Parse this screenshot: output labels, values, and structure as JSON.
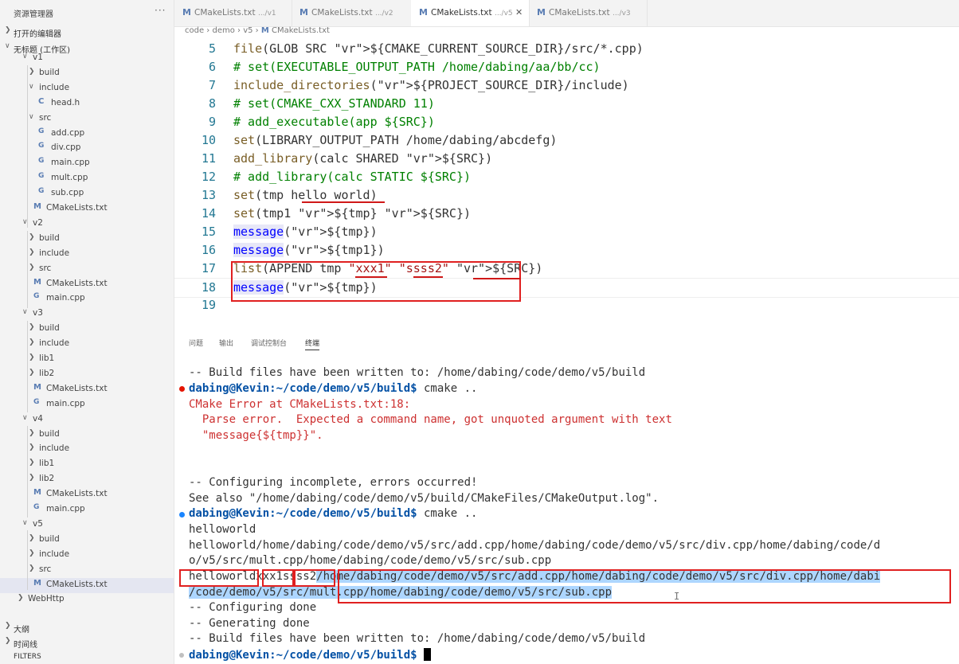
{
  "explorer": {
    "title": "资源管理器",
    "more": "···",
    "open_editors": "打开的编辑器",
    "workspace": "无标题 (工作区)",
    "tree": [
      {
        "label": "v1",
        "kind": "folder",
        "open": true
      },
      {
        "label": "build",
        "kind": "folder",
        "open": false
      },
      {
        "label": "include",
        "kind": "folder",
        "open": true
      },
      {
        "label": "head.h",
        "kind": "c"
      },
      {
        "label": "src",
        "kind": "folder",
        "open": true
      },
      {
        "label": "add.cpp",
        "kind": "cpp"
      },
      {
        "label": "div.cpp",
        "kind": "cpp"
      },
      {
        "label": "main.cpp",
        "kind": "cpp"
      },
      {
        "label": "mult.cpp",
        "kind": "cpp"
      },
      {
        "label": "sub.cpp",
        "kind": "cpp"
      },
      {
        "label": "CMakeLists.txt",
        "kind": "cmake"
      },
      {
        "label": "v2",
        "kind": "folder",
        "open": true
      },
      {
        "label": "build",
        "kind": "folder",
        "open": false
      },
      {
        "label": "include",
        "kind": "folder",
        "open": false
      },
      {
        "label": "src",
        "kind": "folder",
        "open": false
      },
      {
        "label": "CMakeLists.txt",
        "kind": "cmake"
      },
      {
        "label": "main.cpp",
        "kind": "cpp"
      },
      {
        "label": "v3",
        "kind": "folder",
        "open": true
      },
      {
        "label": "build",
        "kind": "folder",
        "open": false
      },
      {
        "label": "include",
        "kind": "folder",
        "open": false
      },
      {
        "label": "lib1",
        "kind": "folder",
        "open": false
      },
      {
        "label": "lib2",
        "kind": "folder",
        "open": false
      },
      {
        "label": "CMakeLists.txt",
        "kind": "cmake"
      },
      {
        "label": "main.cpp",
        "kind": "cpp"
      },
      {
        "label": "v4",
        "kind": "folder",
        "open": true
      },
      {
        "label": "build",
        "kind": "folder",
        "open": false
      },
      {
        "label": "include",
        "kind": "folder",
        "open": false
      },
      {
        "label": "lib1",
        "kind": "folder",
        "open": false
      },
      {
        "label": "lib2",
        "kind": "folder",
        "open": false
      },
      {
        "label": "CMakeLists.txt",
        "kind": "cmake"
      },
      {
        "label": "main.cpp",
        "kind": "cpp"
      },
      {
        "label": "v5",
        "kind": "folder",
        "open": true
      },
      {
        "label": "build",
        "kind": "folder",
        "open": false
      },
      {
        "label": "include",
        "kind": "folder",
        "open": false
      },
      {
        "label": "src",
        "kind": "folder",
        "open": false
      },
      {
        "label": "CMakeLists.txt",
        "kind": "cmake",
        "selected": true
      },
      {
        "label": "WebHttp",
        "kind": "folder",
        "open": false
      }
    ],
    "outline": "大纲",
    "timeline": "时间线",
    "filters": "FILTERS"
  },
  "tabs": [
    {
      "name": "CMakeLists.txt",
      "dir": ".../v1"
    },
    {
      "name": "CMakeLists.txt",
      "dir": ".../v2"
    },
    {
      "name": "CMakeLists.txt",
      "dir": ".../v5",
      "active": true
    },
    {
      "name": "CMakeLists.txt",
      "dir": ".../v3"
    }
  ],
  "breadcrumb": [
    "code",
    "demo",
    "v5",
    "CMakeLists.txt"
  ],
  "code_lines": [
    {
      "n": "5",
      "text": "file(GLOB SRC ${CMAKE_CURRENT_SOURCE_DIR}/src/*.cpp)"
    },
    {
      "n": "6",
      "text": "# set(EXECUTABLE_OUTPUT_PATH /home/dabing/aa/bb/cc)"
    },
    {
      "n": "7",
      "text": "include_directories(${PROJECT_SOURCE_DIR}/include)"
    },
    {
      "n": "8",
      "text": "# set(CMAKE_CXX_STANDARD 11)"
    },
    {
      "n": "9",
      "text": "# add_executable(app ${SRC})"
    },
    {
      "n": "10",
      "text": "set(LIBRARY_OUTPUT_PATH /home/dabing/abcdefg)"
    },
    {
      "n": "11",
      "text": "add_library(calc SHARED ${SRC})"
    },
    {
      "n": "12",
      "text": "# add_library(calc STATIC ${SRC})"
    },
    {
      "n": "13",
      "text": "set(tmp hello world)"
    },
    {
      "n": "14",
      "text": "set(tmp1 ${tmp} ${SRC})"
    },
    {
      "n": "15",
      "text": "message(${tmp})"
    },
    {
      "n": "16",
      "text": "message(${tmp1})"
    },
    {
      "n": "17",
      "text": "list(APPEND tmp \"xxx1\" \"ssss2\" ${SRC})"
    },
    {
      "n": "18",
      "text": "message(${tmp})"
    },
    {
      "n": "19",
      "text": ""
    }
  ],
  "panel_tabs": [
    "问题",
    "输出",
    "调试控制台",
    "终端"
  ],
  "terminal": {
    "l1": "-- Build files have been written to: /home/dabing/code/demo/v5/build",
    "prompt": "dabing@Kevin:~/code/demo/v5/build$",
    "cmd": " cmake ..",
    "err1": "CMake Error at CMakeLists.txt:18:",
    "err2": "  Parse error.  Expected a command name, got unquoted argument with text",
    "err3": "  \"message{${tmp}}\".",
    "l5": "-- Configuring incomplete, errors occurred!",
    "l6": "See also \"/home/dabing/code/demo/v5/build/CMakeFiles/CMakeOutput.log\".",
    "o1": "helloworld",
    "o2": "helloworld/home/dabing/code/demo/v5/src/add.cpp/home/dabing/code/demo/v5/src/div.cpp/home/dabing/code/d",
    "o3": "o/v5/src/mult.cpp/home/dabing/code/demo/v5/src/sub.cpp",
    "o4a": "helloworld",
    "o4b": "xxx1",
    "o4c": "ssss2",
    "o4d": "/home/dabing/code/demo/v5/src/add.cpp/home/dabing/code/demo/v5/src/div.cpp/home/dabi",
    "o5": "/code/demo/v5/src/mult.cpp/home/dabing/code/demo/v5/src/sub.cpp",
    "c1": "-- Configuring done",
    "c2": "-- Generating done",
    "c3": "-- Build files have been written to: /home/dabing/code/demo/v5/build"
  },
  "colors": {
    "error_dot": "#e51400",
    "ok_dot": "#1a85ff",
    "annotation": "#e02020"
  }
}
